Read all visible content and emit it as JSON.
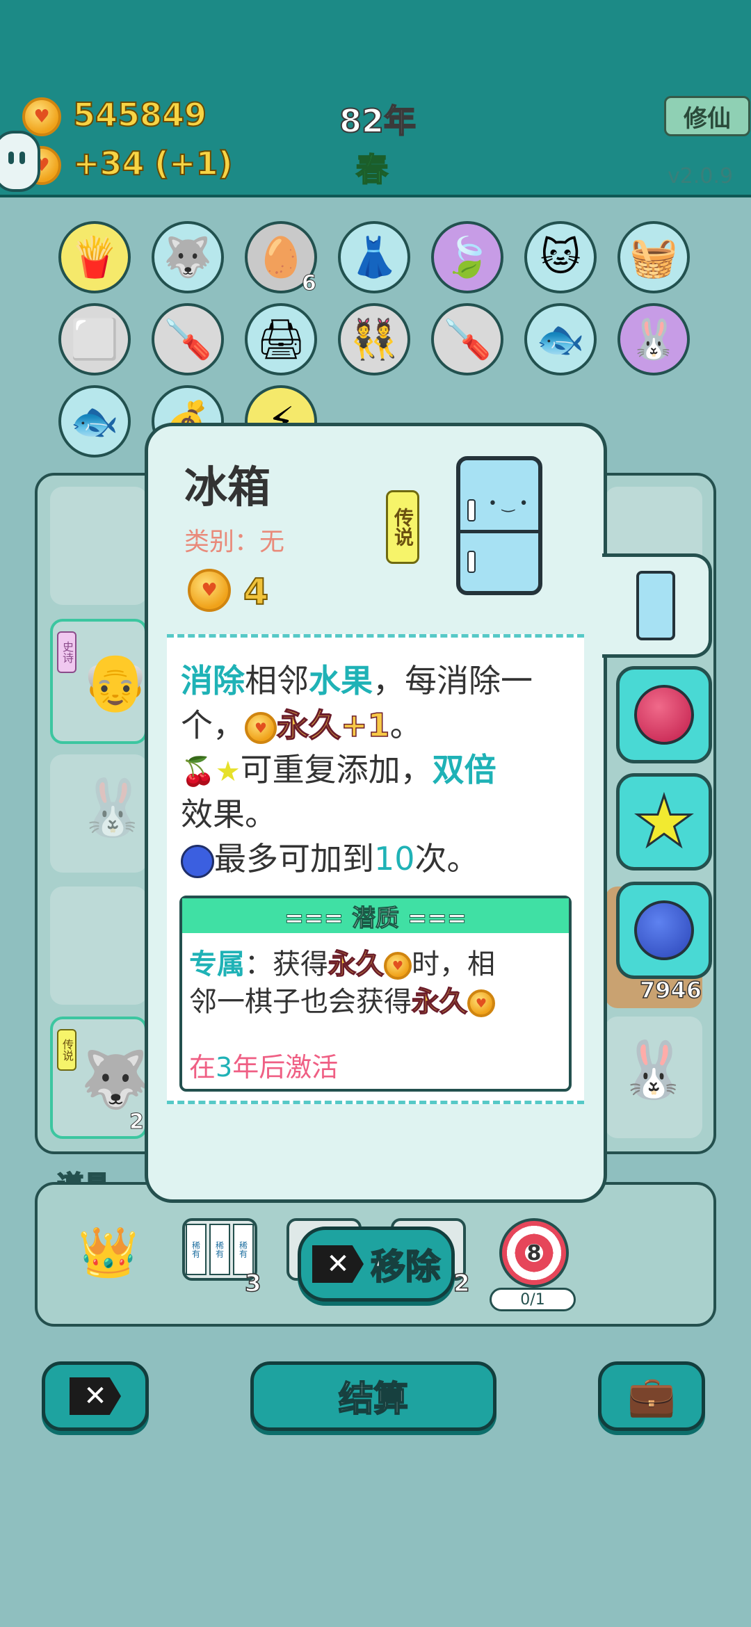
{
  "top": {
    "coins": "545849",
    "income": "+34",
    "income_bonus": "(+1)",
    "year": "82年",
    "season": "春",
    "xiuxian_label": "修仙",
    "version": "v2.0.9"
  },
  "pieces_row1_counts": {
    "egg_tray": "6"
  },
  "board": {
    "items_section_label": "道具",
    "left_badges": {
      "shishi": "史诗",
      "chuanshuo": "传说"
    },
    "right_value": "7946",
    "husky_count": "2"
  },
  "items": {
    "slot_machine_count": "3",
    "slot_machine2_count": "2",
    "target_number": "8",
    "target_progress": "0/1",
    "reel_labels": [
      "稀有",
      "稀有",
      "稀有"
    ]
  },
  "card": {
    "title": "冰箱",
    "category": "类别：无",
    "rarity": "传说",
    "cost": "4",
    "desc": {
      "l1a": "消除",
      "l1b": "相邻",
      "l1c": "水果",
      "l1d": "，每消除一",
      "l2a": "个，",
      "l2b": "永久+1",
      "l2c": "。",
      "l3a": "可重复添加，",
      "l3b": "双倍",
      "l4": "效果。",
      "l5a": "最多可加到",
      "l5b": "10",
      "l5c": "次。"
    },
    "potential": {
      "header": "=== 潜质 ===",
      "p1a": "专属",
      "p1b": "：获得",
      "p1c": "永久",
      "p1d": "时，相",
      "p2a": "邻一棋子也会获得",
      "p2b": "永久",
      "activate_a": "在",
      "activate_num": "3",
      "activate_b": "年后激活"
    }
  },
  "buttons": {
    "remove": "移除",
    "settle": "结算"
  },
  "colors": {
    "teal": "#1c8a86",
    "accent_cyan": "#1fb2b6",
    "popup_bg": "#dff3f1",
    "potential_header": "#40e0a4"
  }
}
